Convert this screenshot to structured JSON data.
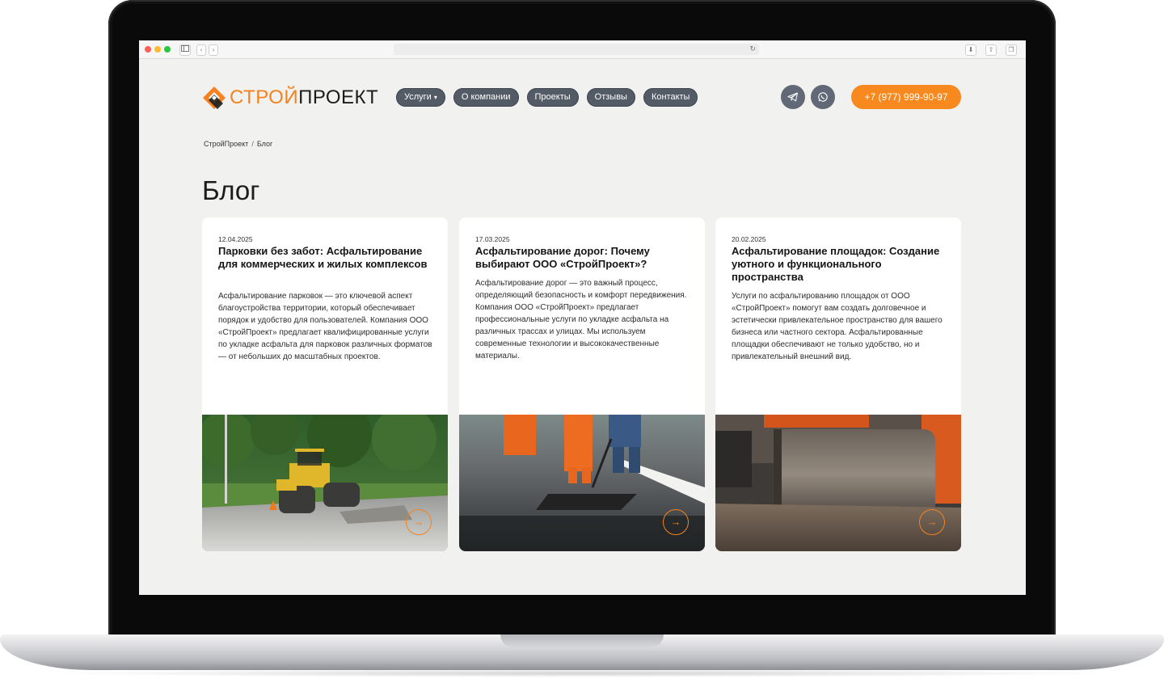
{
  "browser": {
    "back_icon": "chevron-left-icon",
    "forward_icon": "chevron-right-icon",
    "sidebar_icon": "sidebar-icon",
    "reload_icon": "reload-icon",
    "download_icon": "download-icon",
    "share_icon": "share-icon",
    "tabs_icon": "tabs-icon"
  },
  "brand": {
    "logo_part1": "СТРОЙ",
    "logo_part2": "ПРОЕКТ",
    "accent_color": "#f5821f",
    "dark_color": "#1c1c1c"
  },
  "nav": {
    "items": [
      {
        "label": "Услуги",
        "caret": "▾"
      },
      {
        "label": "О компании"
      },
      {
        "label": "Проекты"
      },
      {
        "label": "Отзывы"
      },
      {
        "label": "Контакты"
      }
    ]
  },
  "header": {
    "telegram_icon": "telegram-icon",
    "whatsapp_icon": "whatsapp-icon",
    "phone": "+7 (977) 999-90-97"
  },
  "breadcrumb": {
    "home": "СтройПроект",
    "separator": "/",
    "current": "Блог"
  },
  "page": {
    "title": "Блог"
  },
  "posts": [
    {
      "date": "12.04.2025",
      "title": "Парковки без забот: Асфальтирование для коммерческих и жилых комплексов",
      "text": "Асфальтирование парковок — это ключевой аспект благоустройства территории, который обеспечивает порядок и удобство для пользователей. Компания ООО «СтройПроект» предлагает квалифицированные услуги по укладке асфальта для парковок различных форматов — от небольших до масштабных проектов.",
      "image": "road-roller-in-park-photo"
    },
    {
      "date": "17.03.2025",
      "title": "Асфальтирование дорог: Почему выбирают ООО «СтройПроект»?",
      "text": "Асфальтирование дорог — это важный процесс, определяющий безопасность и комфорт передвижения. Компания ООО «СтройПроект» предлагает профессиональные услуги по укладке асфальта на различных трассах и улицах. Мы используем современные технологии и высококачественные материалы.",
      "image": "road-workers-photo"
    },
    {
      "date": "20.02.2025",
      "title": "Асфальтирование площадок: Создание уютного и функционального пространства",
      "text": "Услуги по асфальтированию площадок от ООО «СтройПроект» помогут вам создать долговечное и эстетически привлекательное пространство для вашего бизнеса или частного сектора. Асфальтированные площадки обеспечивают не только удобство, но и привлекательный внешний вид.",
      "image": "roller-drum-closeup-photo"
    }
  ],
  "card_arrow": "→"
}
